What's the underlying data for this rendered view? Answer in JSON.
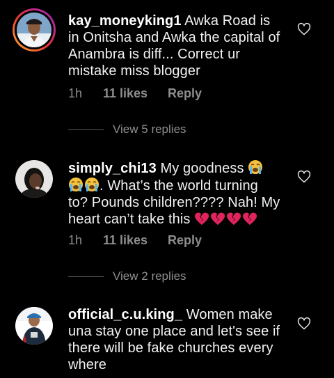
{
  "comments": [
    {
      "username": "kay_moneyking1",
      "text": "Awka Road is in Onitsha and Awka the capital of Anambra is diff... Correct ur mistake miss blogger",
      "time": "1h",
      "likes": "11 likes",
      "reply": "Reply",
      "view_replies": "View 5 replies",
      "avatar_story_ring": true
    },
    {
      "username": "simply_chi13",
      "text": "My goodness",
      "text_after_emoji": ". What’s the world turning to? Pounds children???? Nah! My heart can’t take this",
      "emoji_inline": [
        "loudly-crying-face",
        "loudly-crying-face",
        "loudly-crying-face"
      ],
      "emoji_trailing": [
        "broken-heart",
        "broken-heart",
        "broken-heart",
        "broken-heart"
      ],
      "time": "1h",
      "likes": "11 likes",
      "reply": "Reply",
      "view_replies": "View 2 replies"
    },
    {
      "username": "official_c.u.king_",
      "text": "Women make una stay one place and let's see if there will be fake churches every where"
    }
  ],
  "colors": {
    "background": "#000000",
    "text": "#ffffff",
    "muted": "#8e8e8e",
    "broken_heart": "#e0245e"
  }
}
